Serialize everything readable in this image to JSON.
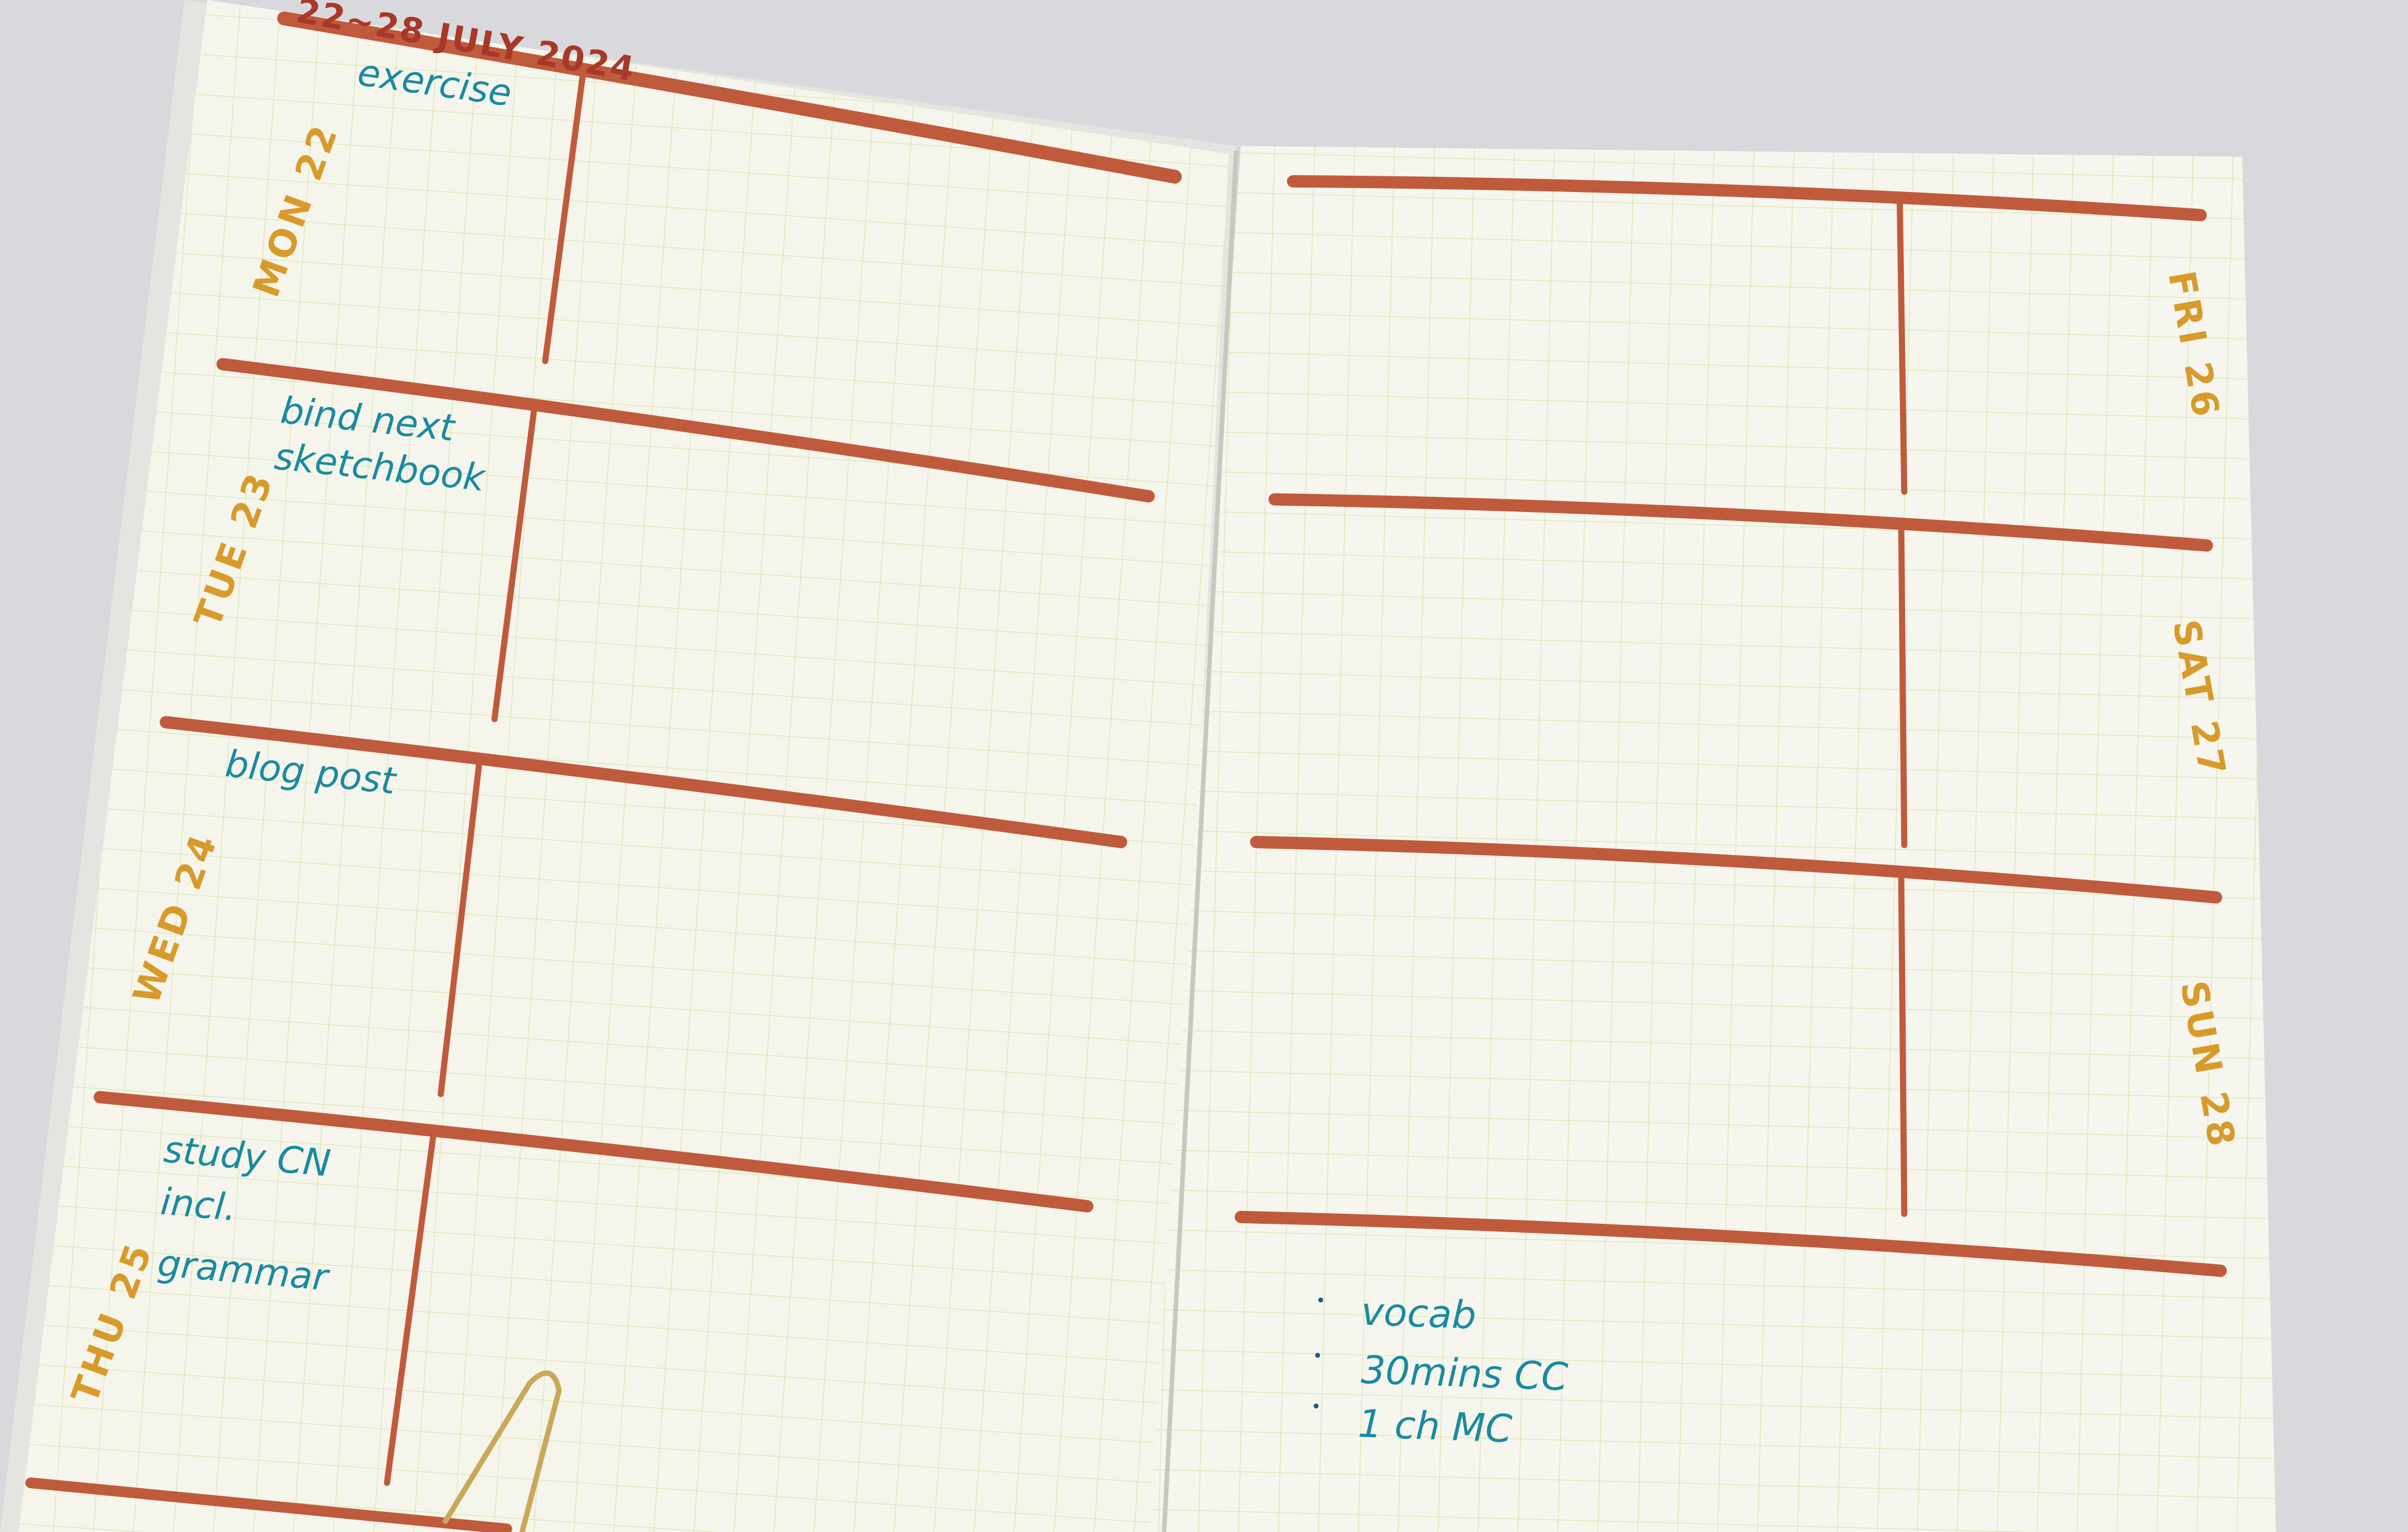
{
  "notebook": {
    "week_title": "22~28 JULY 2024",
    "colors": {
      "rule_ink": "#c05a3c",
      "day_ink": "#d89a2a",
      "task_ink": "#1a8aa0",
      "paper": "#f6f5ec",
      "grid": "#d9e8b8"
    },
    "left_page": {
      "days": [
        {
          "label": "MON 22",
          "tasks": [
            "exercise"
          ]
        },
        {
          "label": "TUE 23",
          "tasks": [
            "bind next",
            "sketchbook"
          ]
        },
        {
          "label": "WED 24",
          "tasks": [
            "blog post"
          ]
        },
        {
          "label": "THU 25",
          "tasks": [
            "study CN",
            "incl.",
            "grammar"
          ]
        }
      ]
    },
    "right_page": {
      "days": [
        {
          "label": "FRI 26"
        },
        {
          "label": "SAT 27"
        },
        {
          "label": "SUN 28"
        }
      ],
      "notes": [
        "vocab",
        "30mins CC",
        "1 ch MC"
      ]
    }
  }
}
